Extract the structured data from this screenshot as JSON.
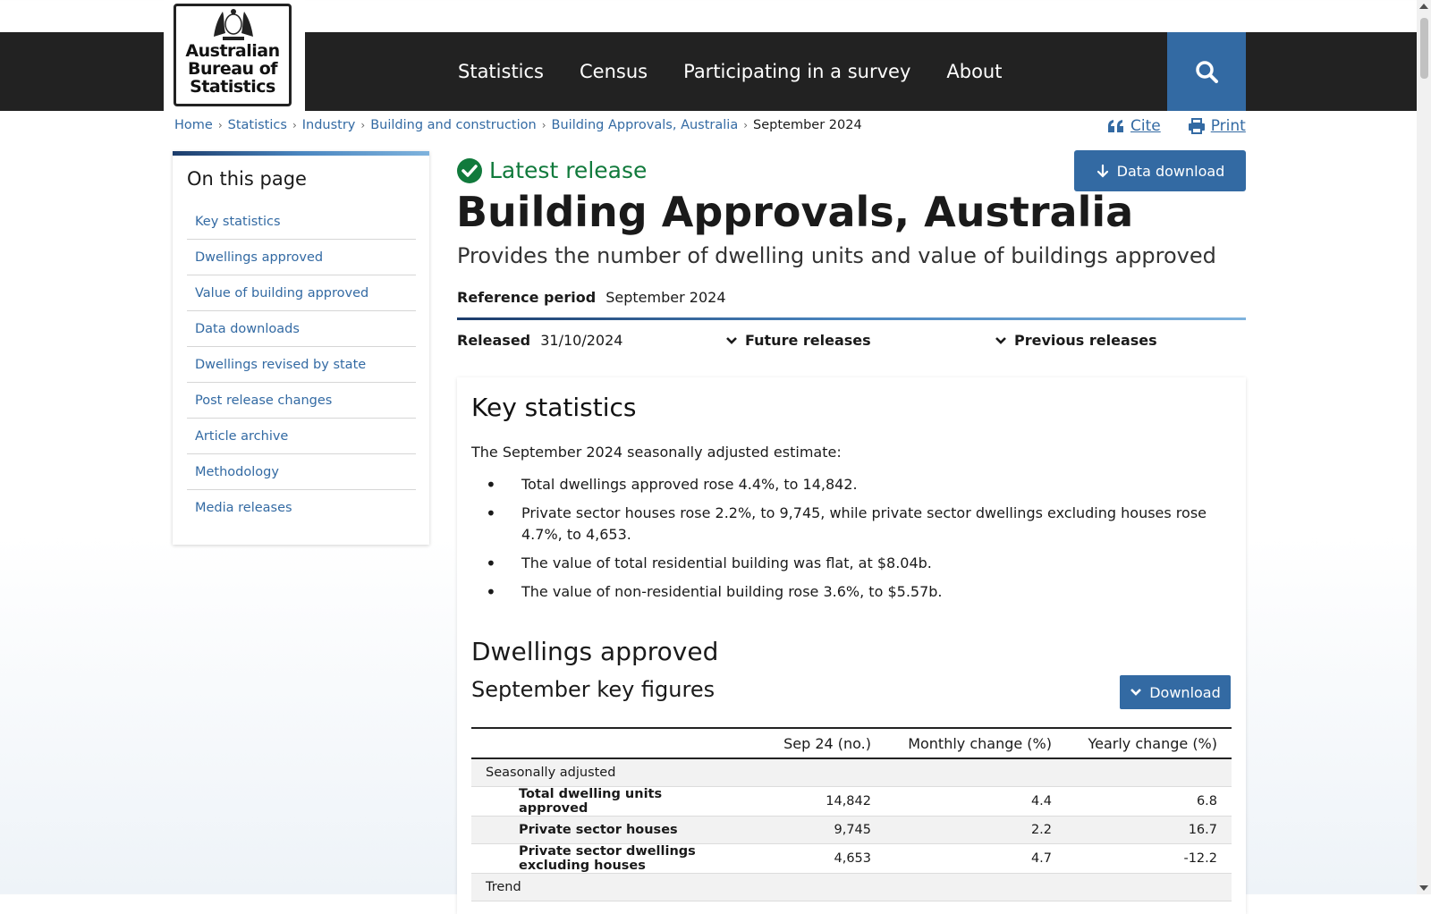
{
  "header": {
    "logo_text": "Australian Bureau of Statistics",
    "nav": [
      "Statistics",
      "Census",
      "Participating in a survey",
      "About"
    ]
  },
  "breadcrumb": [
    "Home",
    "Statistics",
    "Industry",
    "Building and construction",
    "Building Approvals, Australia",
    "September 2024"
  ],
  "actions": {
    "cite": "Cite",
    "print": "Print"
  },
  "sidebar": {
    "title": "On this page",
    "items": [
      "Key statistics",
      "Dwellings approved",
      "Value of building approved",
      "Data downloads",
      "Dwellings revised by state",
      "Post release changes",
      "Article archive",
      "Methodology",
      "Media releases"
    ]
  },
  "release": {
    "latest_label": "Latest release",
    "data_download": "Data download",
    "title": "Building Approvals, Australia",
    "subtitle": "Provides the number of dwelling units and value of buildings approved",
    "reference_period_label": "Reference period",
    "reference_period": "September 2024",
    "released_label": "Released",
    "released_date": "31/10/2024",
    "future_releases": "Future releases",
    "previous_releases": "Previous releases"
  },
  "key_statistics": {
    "title": "Key statistics",
    "intro": "The September 2024 seasonally adjusted estimate:",
    "bullets": [
      "Total dwellings approved rose 4.4%, to 14,842.",
      "Private sector houses rose 2.2%, to 9,745, while private sector dwellings excluding houses rose 4.7%, to 4,653.",
      "The value of total residential building was flat, at $8.04b.",
      "The value of non-residential building rose 3.6%, to $5.57b."
    ]
  },
  "dwellings": {
    "title": "Dwellings approved",
    "subtitle": "September key figures",
    "download": "Download",
    "table": {
      "headers": [
        "",
        "Sep 24 (no.)",
        "Monthly change (%)",
        "Yearly change (%)"
      ],
      "group1": "Seasonally adjusted",
      "rows": [
        [
          "Total dwelling units approved",
          "14,842",
          "4.4",
          "6.8"
        ],
        [
          "Private sector houses",
          "9,745",
          "2.2",
          "16.7"
        ],
        [
          "Private sector dwellings excluding houses",
          "4,653",
          "4.7",
          "-12.2"
        ]
      ],
      "group2": "Trend"
    }
  }
}
